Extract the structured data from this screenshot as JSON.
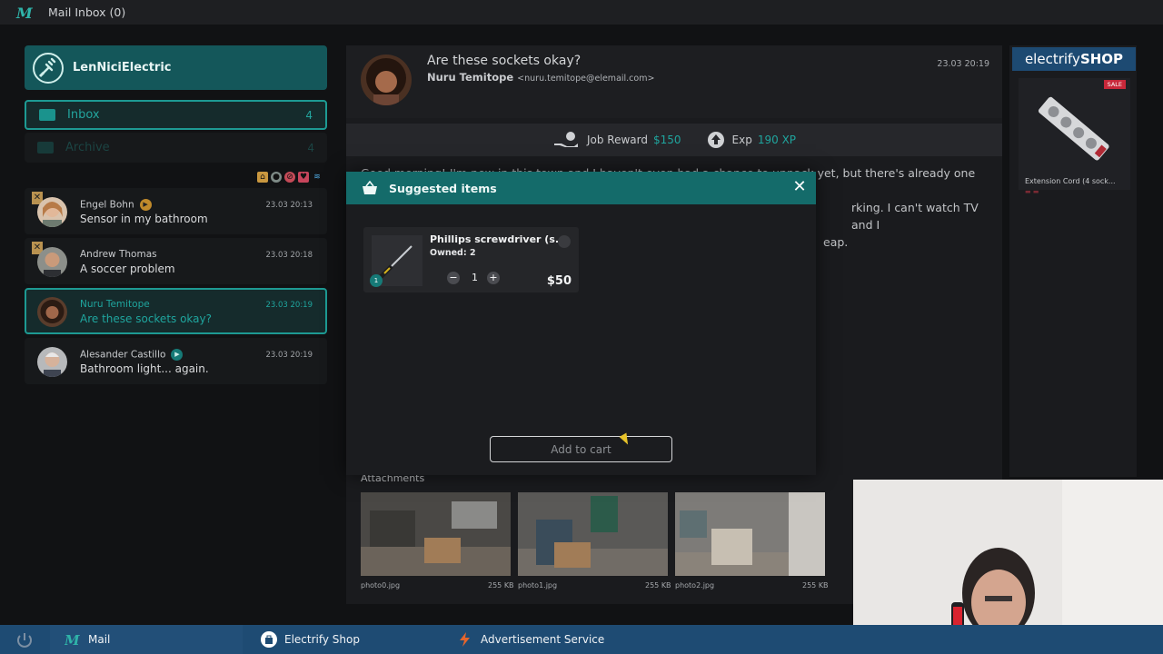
{
  "titlebar": {
    "title": "Mail Inbox (0)"
  },
  "brand": {
    "name": "LenNiciElectric"
  },
  "folders": [
    {
      "label": "Inbox",
      "count": "4"
    },
    {
      "label": "Archive",
      "count": "4"
    }
  ],
  "mails": [
    {
      "sender": "Engel Bohn",
      "subject": "Sensor in my bathroom",
      "date": "23.03 20:13"
    },
    {
      "sender": "Andrew Thomas",
      "subject": "A soccer problem",
      "date": "23.03 20:18"
    },
    {
      "sender": "Nuru Temitope",
      "subject": "Are these sockets okay?",
      "date": "23.03 20:19"
    },
    {
      "sender": "Alesander Castillo",
      "subject": "Bathroom light... again.",
      "date": "23.03 20:19"
    }
  ],
  "reader": {
    "subject": "Are these sockets okay?",
    "from_name": "Nuru Temitope",
    "from_email": "<nuru.temitope@elemail.com>",
    "date": "23.03 20:19",
    "job_reward_label": "Job Reward",
    "job_reward_value": "$150",
    "exp_label": "Exp",
    "exp_value": "190 XP",
    "body_line1": "Good morning! I'm new in this town and I haven't even had a chance to unpack yet, but there's already one thing",
    "body_line2": "rking. I can't watch TV and I",
    "body_line3": "eap.",
    "attachments_label": "Attachments",
    "attachments": [
      {
        "name": "photo0.jpg",
        "size": "255 KB"
      },
      {
        "name": "photo1.jpg",
        "size": "255 KB"
      },
      {
        "name": "photo2.jpg",
        "size": "255 KB"
      }
    ]
  },
  "shop": {
    "logo_light": "electrify",
    "logo_bold": "SHOP",
    "sale": "SALE",
    "item_name": "Extension Cord (4 sock..."
  },
  "modal": {
    "title": "Suggested items",
    "item_name": "Phillips screwdriver (s...",
    "owned": "Owned: 2",
    "qty": "1",
    "badge": "1",
    "price": "$50",
    "add_to_cart": "Add to cart"
  },
  "taskbar": {
    "mail": "Mail",
    "shop": "Electrify Shop",
    "ads": "Advertisement Service"
  },
  "colors": {
    "accent": "#1fa59e",
    "brand_bg": "#14575a",
    "modal_head": "#146b6a",
    "taskbar": "#1e4b73"
  }
}
